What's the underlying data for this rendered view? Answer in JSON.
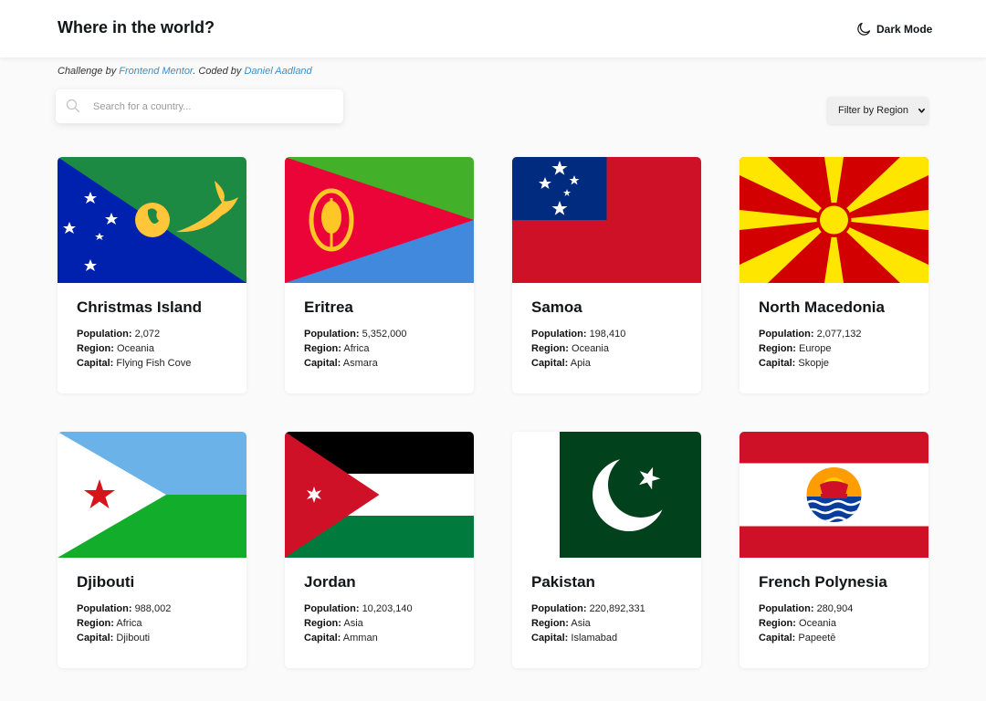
{
  "header": {
    "title": "Where in the world?",
    "dark_mode_label": "Dark Mode",
    "dark_mode_icon": "moon-icon"
  },
  "credit": {
    "prefix": "Challenge by",
    "link1": "Frontend Mentor",
    "middle": ". Coded by",
    "link2": "Daniel Aadland"
  },
  "search": {
    "placeholder": "Search for a country...",
    "value": "",
    "icon": "search-icon"
  },
  "filter": {
    "label": "Filter by Region",
    "icon": "chevron-down-icon"
  },
  "labels": {
    "population": "Population:",
    "region": "Region:",
    "capital": "Capital:"
  },
  "countries": [
    {
      "name": "Christmas Island",
      "population": "2,072",
      "region": "Oceania",
      "capital": "Flying Fish Cove"
    },
    {
      "name": "Eritrea",
      "population": "5,352,000",
      "region": "Africa",
      "capital": "Asmara"
    },
    {
      "name": "Samoa",
      "population": "198,410",
      "region": "Oceania",
      "capital": "Apia"
    },
    {
      "name": "North Macedonia",
      "population": "2,077,132",
      "region": "Europe",
      "capital": "Skopje"
    },
    {
      "name": "Djibouti",
      "population": "988,002",
      "region": "Africa",
      "capital": "Djibouti"
    },
    {
      "name": "Jordan",
      "population": "10,203,140",
      "region": "Asia",
      "capital": "Amman"
    },
    {
      "name": "Pakistan",
      "population": "220,892,331",
      "region": "Asia",
      "capital": "Islamabad"
    },
    {
      "name": "French Polynesia",
      "population": "280,904",
      "region": "Oceania",
      "capital": "Papeetē"
    }
  ],
  "colors": {
    "link": "#3d8fc8",
    "background": "#fafafa",
    "card": "#ffffff"
  }
}
